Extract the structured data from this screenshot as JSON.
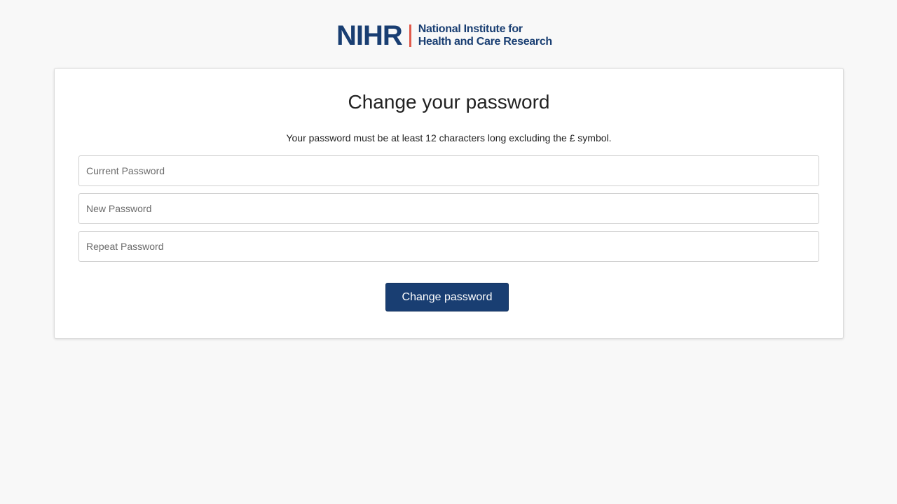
{
  "logo": {
    "acronym": "NIHR",
    "line1": "National Institute for",
    "line2": "Health and Care Research",
    "colors": {
      "brand_blue": "#193e72",
      "divider_red": "#e05a4b"
    }
  },
  "form": {
    "title": "Change your password",
    "hint": "Your password must be at least 12 characters long excluding the £ symbol.",
    "current_password": {
      "placeholder": "Current Password",
      "value": ""
    },
    "new_password": {
      "placeholder": "New Password",
      "value": ""
    },
    "repeat_password": {
      "placeholder": "Repeat Password",
      "value": ""
    },
    "submit_label": "Change password"
  },
  "colors": {
    "page_background": "#f8f8f8",
    "card_background": "#ffffff",
    "button_background": "#193e72",
    "button_text": "#ffffff"
  }
}
